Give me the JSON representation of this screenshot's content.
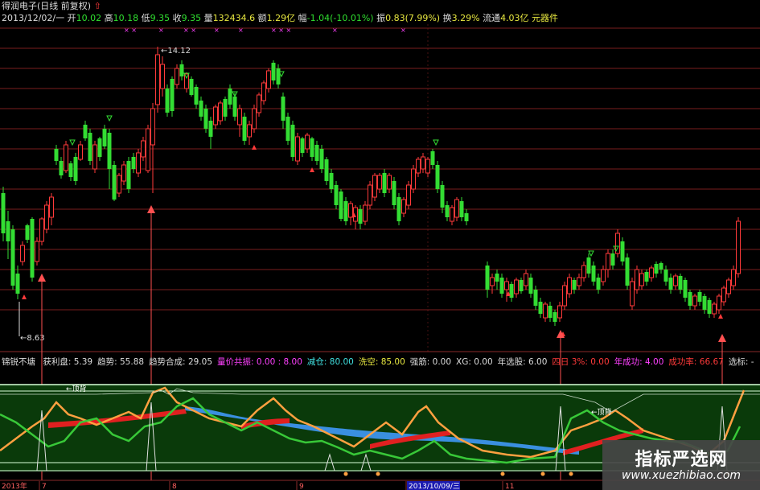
{
  "title": "得润电子(日线 前复权)",
  "quote": {
    "date": "2013/12/02/一",
    "open_label": "开",
    "open": "10.02",
    "high_label": "高",
    "high": "10.18",
    "low_label": "低",
    "low": "9.35",
    "close_label": "收",
    "close": "9.35",
    "vol_label": "量",
    "vol": "132434.6",
    "amt_label": "额",
    "amt": "1.29亿",
    "chg_label": "幅",
    "chg": "-1.04(-10.01%)",
    "amp_label": "振",
    "amp": "0.83(7.99%)",
    "turn_label": "换",
    "turn": "3.29%",
    "float_label": "流通",
    "float": "4.03亿",
    "extra": "元器件"
  },
  "price_labels": {
    "high": "14.12",
    "low": "8.63"
  },
  "indicator": {
    "name": "锦锐不塘",
    "items": [
      {
        "label": "获利盘:",
        "value": "5.39",
        "color": "#dddddd"
      },
      {
        "label": "趋势:",
        "value": "55.88",
        "color": "#dddddd"
      },
      {
        "label": "趋势合成:",
        "value": "29.05",
        "color": "#dddddd"
      },
      {
        "label": "量价共振:",
        "value": "0.00 : 8.00",
        "color": "#ff40ff"
      },
      {
        "label": "减仓:",
        "value": "80.00",
        "color": "#40e0e0"
      },
      {
        "label": "洗空:",
        "value": "85.00",
        "color": "#e8e840"
      },
      {
        "label": "强筋:",
        "value": "0.00",
        "color": "#dddddd"
      },
      {
        "label": "XG:",
        "value": "0.00",
        "color": "#dddddd"
      },
      {
        "label": "年选股:",
        "value": "6.00",
        "color": "#dddddd"
      },
      {
        "label": "四日",
        "value": "3%: 0.00",
        "color": "#ff3a3a"
      },
      {
        "label": "年成功:",
        "value": "4.00",
        "color": "#ff40ff"
      },
      {
        "label": "成功率:",
        "value": "66.67",
        "color": "#ff3a3a"
      },
      {
        "label": "选标:",
        "value": "-",
        "color": "#dddddd"
      }
    ],
    "top_tag_left": "顶背",
    "top_tag_right": "顶背"
  },
  "xaxis": {
    "labels": [
      "2013年",
      "7",
      "8",
      "9",
      "2013/10/09/三",
      "11"
    ]
  },
  "colors": {
    "up": "#ff3a3a",
    "down": "#33dd33",
    "grid": "#7a1e1e",
    "orange": "#ffa040",
    "blue": "#3a8fe0",
    "red_band": "#e02020",
    "green_fill": "#0a3a0a"
  },
  "watermark": {
    "cn": "指标严选网",
    "url": "www.xuezhibiao.com"
  }
}
